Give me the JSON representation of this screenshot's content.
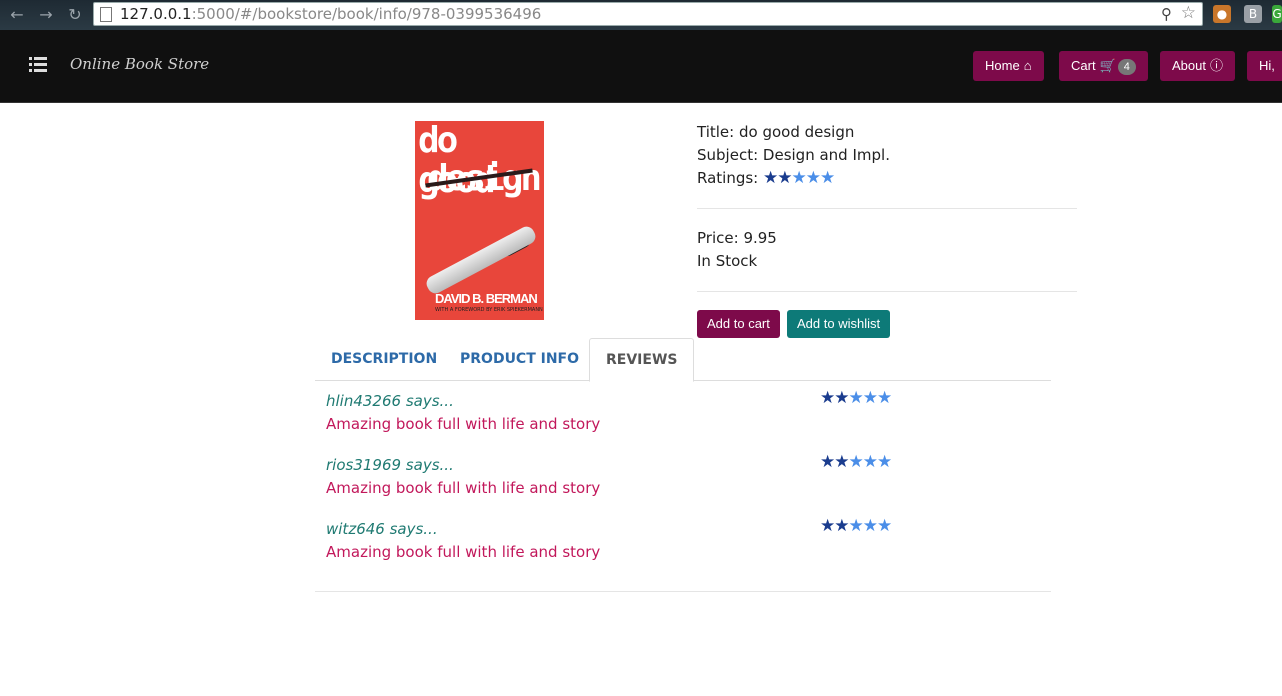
{
  "browser": {
    "url_host": "127.0.0.1",
    "url_rest": ":5000/#/bookstore/book/info/978-0399536496",
    "ext_b": "B",
    "ext_g": "G"
  },
  "navbar": {
    "brand": "Online Book Store",
    "home_label": "Home",
    "cart_label": "Cart",
    "cart_count": "4",
    "about_label": "About",
    "user_label": "Hi,"
  },
  "cover": {
    "line1": "do good",
    "line2": "design",
    "author": "DAVID B. BERMAN",
    "foreword": "WITH A FOREWORD BY ERIK SPIEKERMANN"
  },
  "book": {
    "title_label": "Title:",
    "title": "do good design",
    "subject_label": "Subject:",
    "subject": "Design and Impl.",
    "ratings_label": "Ratings:",
    "rating": 2,
    "rating_max": 5,
    "price_label": "Price:",
    "price": "9.95",
    "stock": "In Stock"
  },
  "actions": {
    "add_to_cart": "Add to cart",
    "add_to_wishlist": "Add to wishlist"
  },
  "tabs": [
    {
      "label": "DESCRIPTION",
      "active": false
    },
    {
      "label": "PRODUCT INFO",
      "active": false
    },
    {
      "label": "REVIEWS",
      "active": true
    }
  ],
  "reviews": [
    {
      "user": "hlin43266 says...",
      "text": "Amazing book full with life and story",
      "rating": 2
    },
    {
      "user": "rios31969 says...",
      "text": "Amazing book full with life and story",
      "rating": 2
    },
    {
      "user": "witz646 says...",
      "text": "Amazing book full with life and story",
      "rating": 2
    }
  ],
  "colors": {
    "primary": "#7d0a4a",
    "teal": "#0d7a78",
    "star_on": "#1a3c8e",
    "star_off": "#4b8ee8"
  },
  "icons": [
    "back-icon",
    "forward-icon",
    "reload-icon",
    "page-icon",
    "zoom-icon",
    "bookmark-star-icon",
    "menu-list-icon",
    "home-icon",
    "cart-icon",
    "info-icon",
    "star-icon"
  ]
}
